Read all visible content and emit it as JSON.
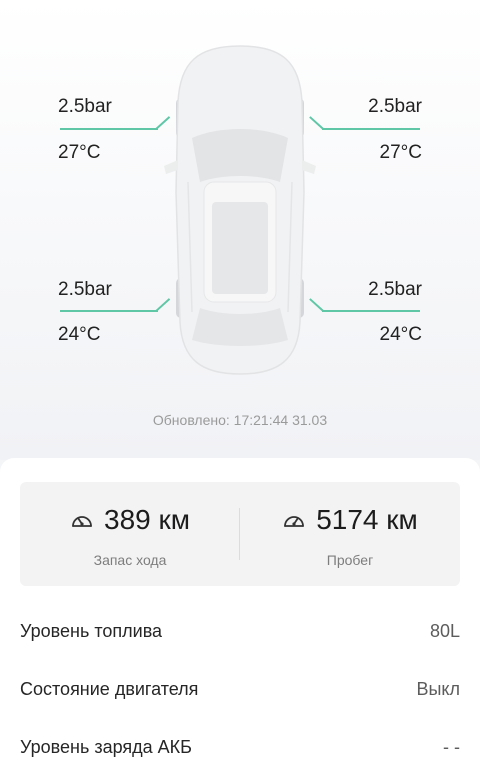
{
  "tires": {
    "front_left": {
      "pressure": "2.5bar",
      "temperature": "27°C"
    },
    "front_right": {
      "pressure": "2.5bar",
      "temperature": "27°C"
    },
    "rear_left": {
      "pressure": "2.5bar",
      "temperature": "24°C"
    },
    "rear_right": {
      "pressure": "2.5bar",
      "temperature": "24°C"
    }
  },
  "updated": "Обновлено: 17:21:44 31.03",
  "stats": {
    "range": {
      "value": "389 км",
      "caption": "Запас хода",
      "icon": "speedometer-icon"
    },
    "mileage": {
      "value": "5174 км",
      "caption": "Пробег",
      "icon": "odometer-icon"
    }
  },
  "rows": [
    {
      "label": "Уровень топлива",
      "value": "80L"
    },
    {
      "label": "Состояние двигателя",
      "value": "Выкл"
    },
    {
      "label": "Уровень заряда АКБ",
      "value": "- -"
    }
  ],
  "colors": {
    "accent": "#5fc7a6",
    "background": "#f4f5f7",
    "card": "#f3f3f4"
  }
}
